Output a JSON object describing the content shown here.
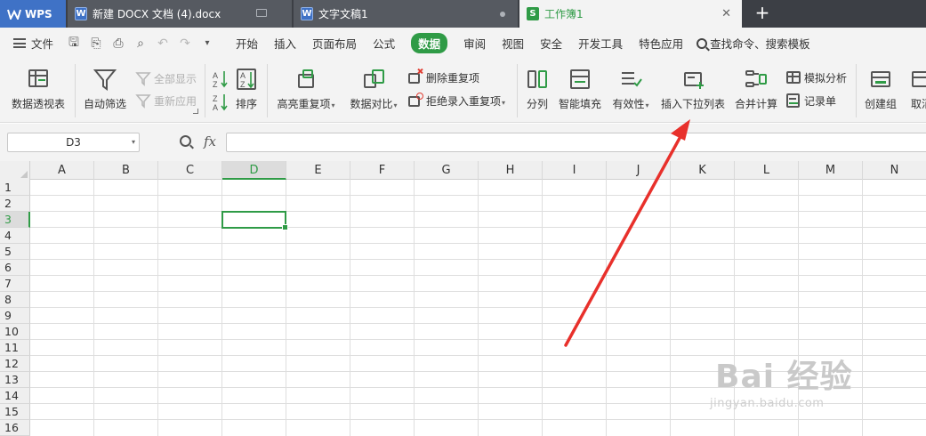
{
  "tabs": {
    "app": "WPS",
    "doc1": "新建 DOCX 文档 (4).docx",
    "doc2": "文字文稿1",
    "sheet": "工作簿1",
    "doc_icon": "W",
    "sheet_icon": "S",
    "new_tab": "+"
  },
  "menu": {
    "file": "文件",
    "items": [
      "开始",
      "插入",
      "页面布局",
      "公式",
      "数据",
      "审阅",
      "视图",
      "安全",
      "开发工具",
      "特色应用"
    ],
    "active": "数据",
    "search": "查找命令、搜索模板"
  },
  "ribbon": {
    "pivot": "数据透视表",
    "autofilter": "自动筛选",
    "show_all": "全部显示",
    "reapply": "重新应用",
    "sort": "排序",
    "highlight_dup": "高亮重复项",
    "compare": "数据对比",
    "remove_dup": "删除重复项",
    "reject_dup": "拒绝录入重复项",
    "split": "分列",
    "smart_fill": "智能填充",
    "validity": "有效性",
    "insert_dropdown": "插入下拉列表",
    "consolidate": "合并计算",
    "what_if": "模拟分析",
    "record_form": "记录单",
    "create_group": "创建组",
    "ungroup": "取消"
  },
  "formula_bar": {
    "cell_ref": "D3",
    "fx": "fx",
    "value": ""
  },
  "grid": {
    "columns": [
      "A",
      "B",
      "C",
      "D",
      "E",
      "F",
      "G",
      "H",
      "I",
      "J",
      "K",
      "L",
      "M",
      "N"
    ],
    "rows": [
      "1",
      "2",
      "3",
      "4",
      "5",
      "6",
      "7",
      "8",
      "9",
      "10",
      "11",
      "12",
      "13",
      "14",
      "15",
      "16"
    ],
    "active_column": "D",
    "active_row": "3"
  },
  "watermark": {
    "brand": "Bai 经验",
    "url": "jingyan.baidu.com"
  },
  "colors": {
    "accent_green": "#2f9b46",
    "annotation_red": "#e8302b",
    "tabbar": "#3c3f45",
    "wps_blue": "#3f72c6"
  }
}
